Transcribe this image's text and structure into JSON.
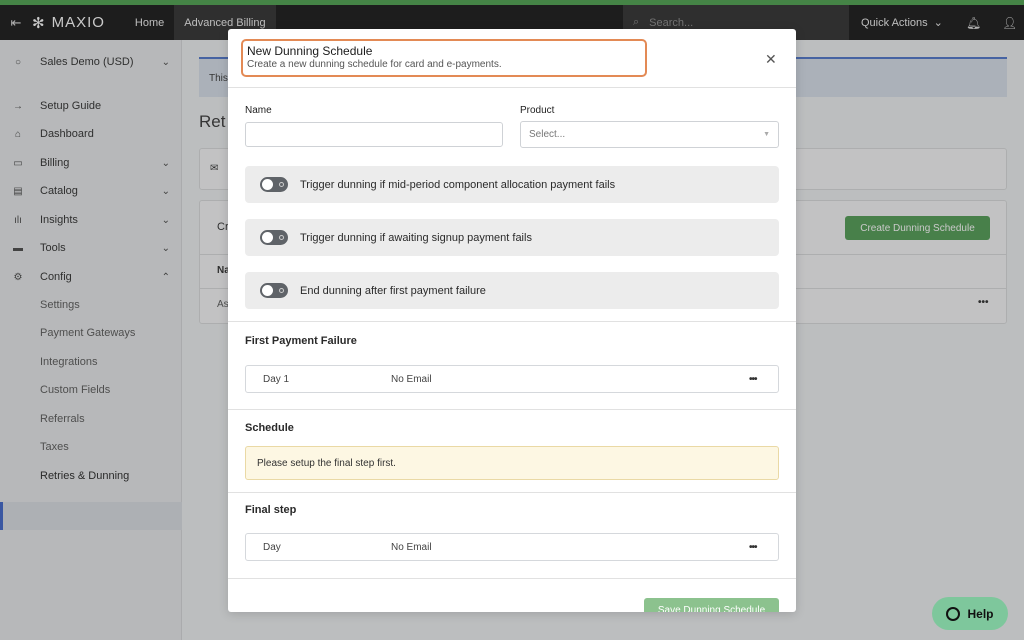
{
  "topnav": {
    "brand": "MAXIO",
    "links": [
      "Home",
      "Advanced Billing"
    ],
    "search_placeholder": "Search...",
    "quick_actions": "Quick Actions"
  },
  "sidebar": {
    "account": "Sales Demo (USD)",
    "items": [
      {
        "label": "Setup Guide",
        "icon": "arrow-right-icon"
      },
      {
        "label": "Dashboard",
        "icon": "home-icon"
      },
      {
        "label": "Billing",
        "icon": "card-icon"
      },
      {
        "label": "Catalog",
        "icon": "book-icon"
      },
      {
        "label": "Insights",
        "icon": "bar-chart-icon"
      },
      {
        "label": "Tools",
        "icon": "briefcase-icon"
      },
      {
        "label": "Config",
        "icon": "gear-icon"
      }
    ],
    "config_subitems": [
      "Settings",
      "Payment Gateways",
      "Integrations",
      "Custom Fields",
      "Referrals",
      "Taxes",
      "Retries & Dunning"
    ],
    "active_subitem": "Retries & Dunning"
  },
  "background": {
    "alert_text": "This",
    "page_title": "Ret",
    "card_header": "Cr",
    "col_header": "Na",
    "row_value": "As",
    "create_button": "Create Dunning Schedule"
  },
  "modal": {
    "title": "New Dunning Schedule",
    "subtitle": "Create a new dunning schedule for card and e-payments.",
    "name_label": "Name",
    "name_value": "",
    "product_label": "Product",
    "product_placeholder": "Select...",
    "toggles": [
      {
        "label": "Trigger dunning if mid-period component allocation payment fails",
        "on": false
      },
      {
        "label": "Trigger dunning if awaiting signup payment fails",
        "on": false
      },
      {
        "label": "End dunning after first payment failure",
        "on": false
      }
    ],
    "first_failure": {
      "heading": "First Payment Failure",
      "day": "Day 1",
      "email": "No Email"
    },
    "schedule": {
      "heading": "Schedule",
      "warning": "Please setup the final step first."
    },
    "final_step": {
      "heading": "Final step",
      "day": "Day",
      "email": "No Email"
    },
    "save_button": "Save Dunning Schedule"
  },
  "help": {
    "label": "Help"
  },
  "colors": {
    "accent_green": "#4d9a4f",
    "highlight_orange": "#e38a55",
    "topbar": "#111111"
  }
}
